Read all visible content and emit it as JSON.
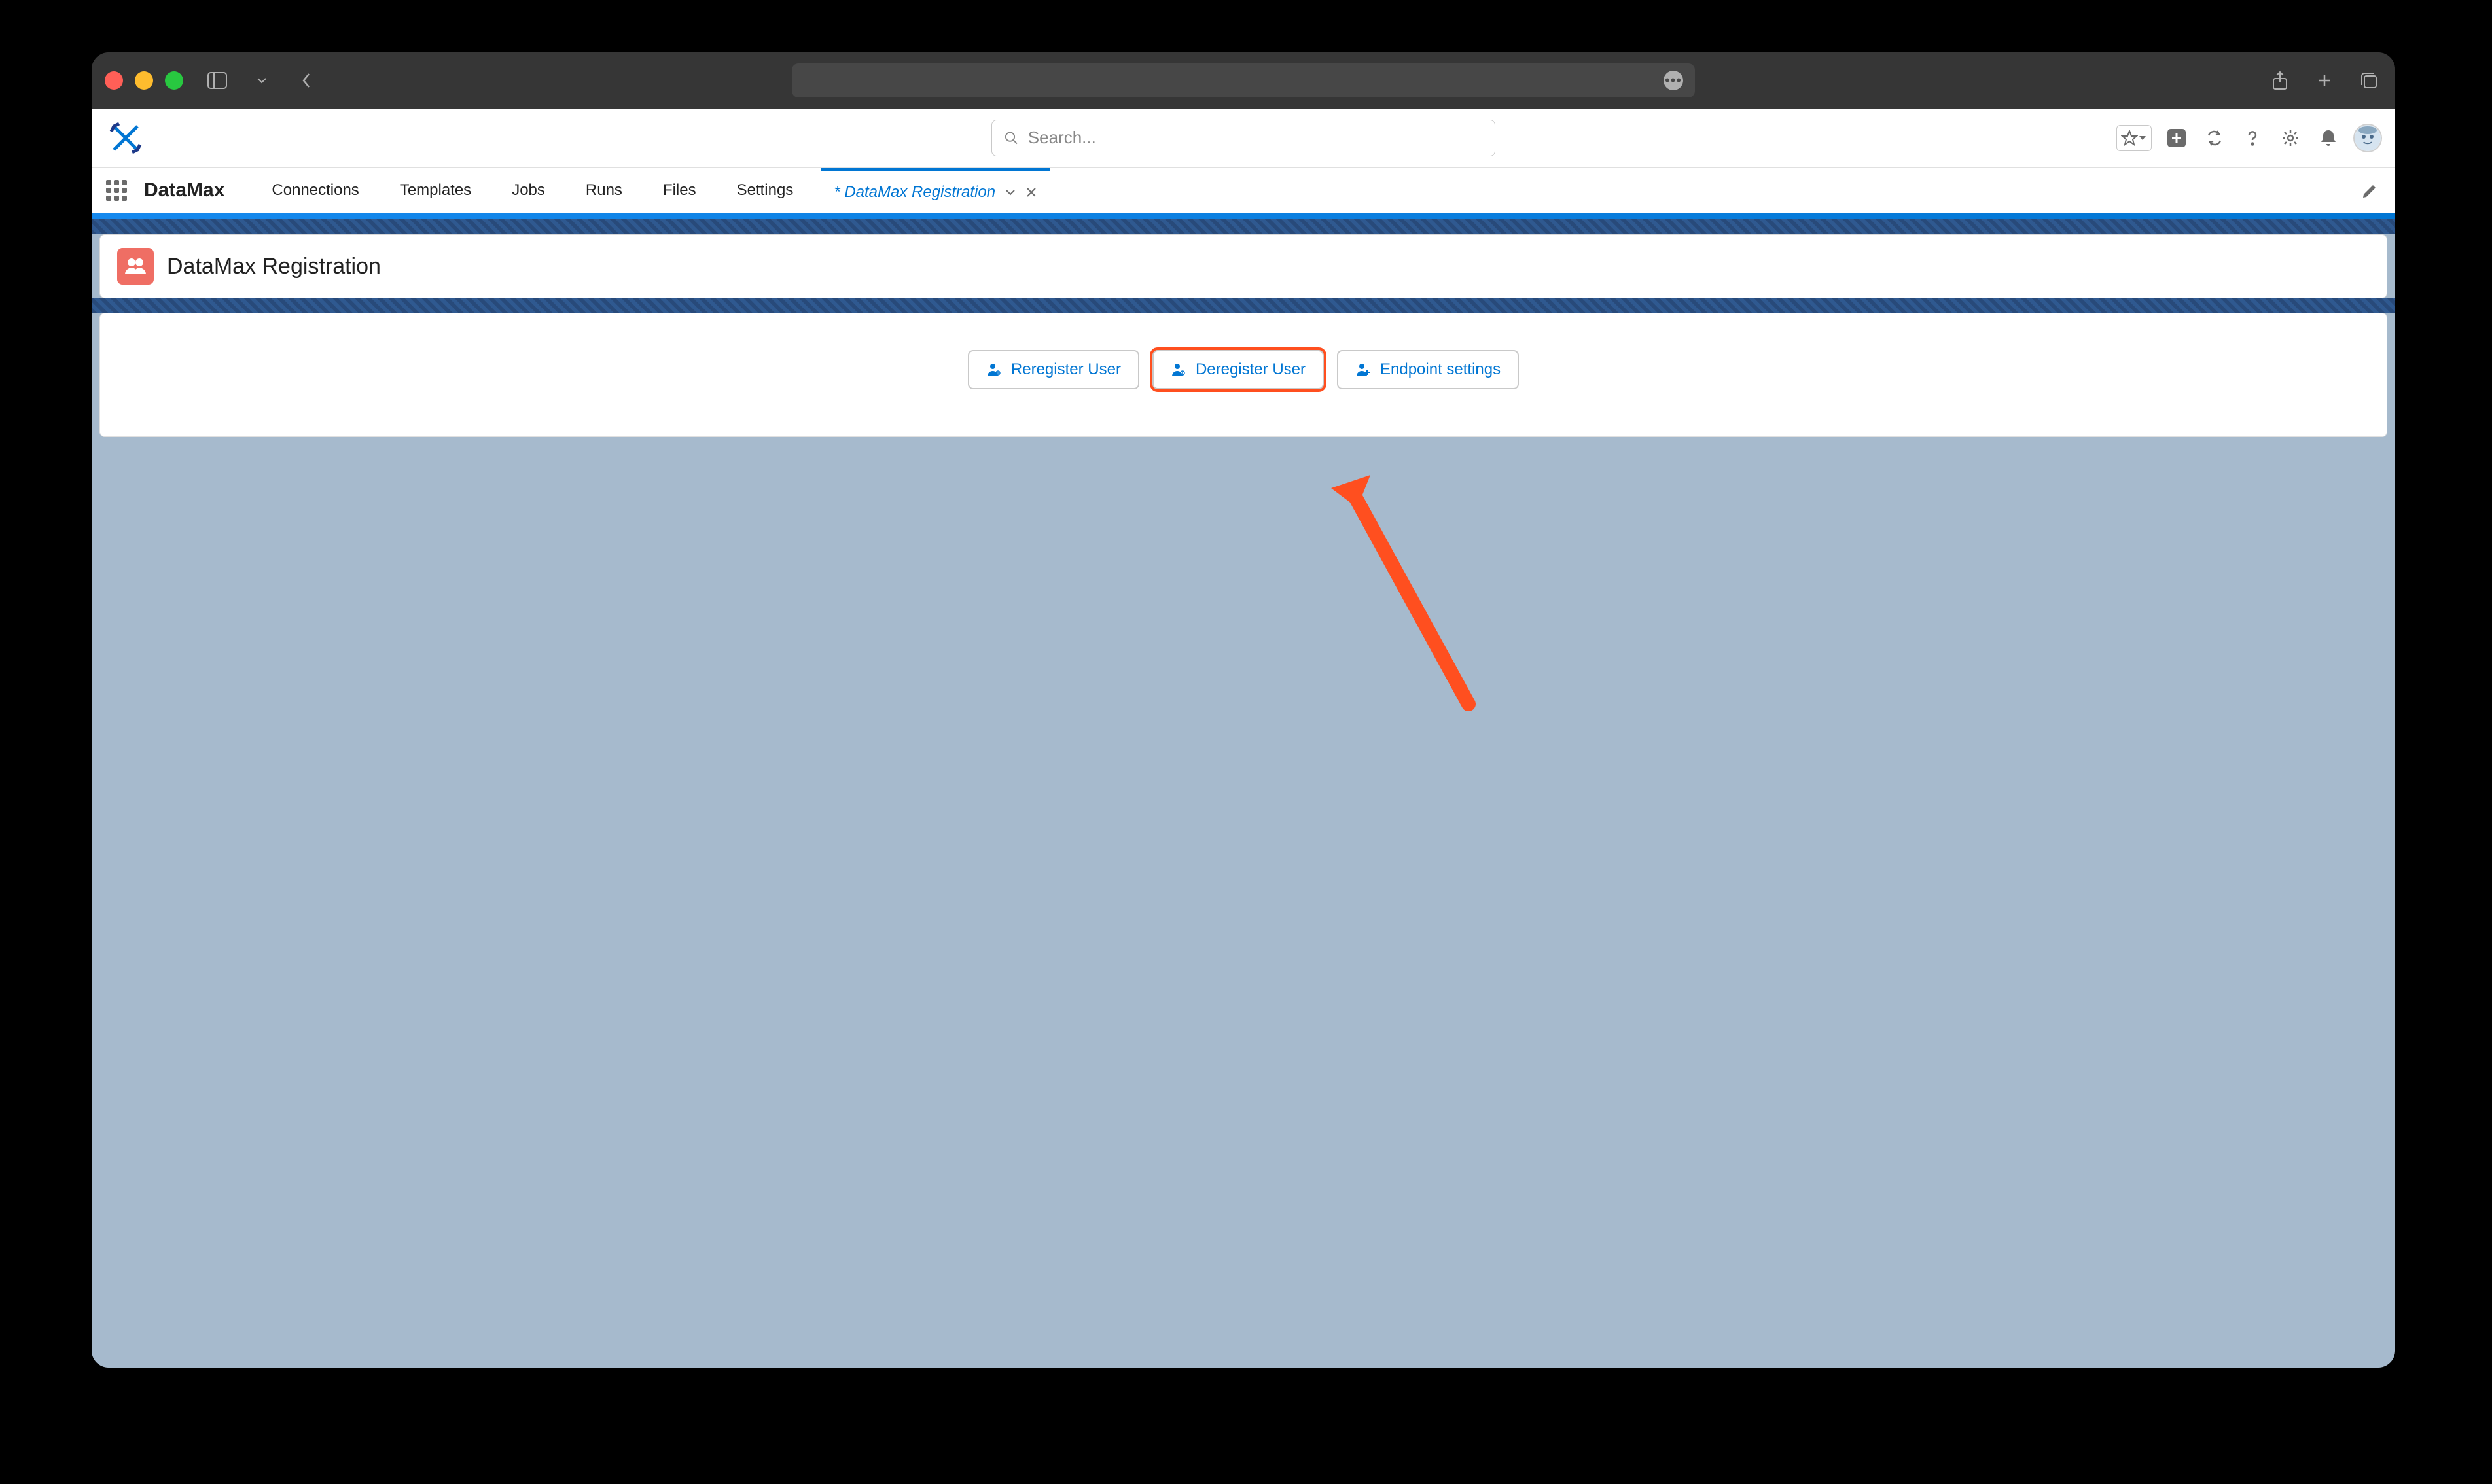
{
  "browser": {
    "address": ""
  },
  "search": {
    "placeholder": "Search..."
  },
  "app": {
    "name": "DataMax",
    "nav": [
      "Connections",
      "Templates",
      "Jobs",
      "Runs",
      "Files",
      "Settings"
    ],
    "active_tab": "* DataMax Registration"
  },
  "page": {
    "title": "DataMax Registration",
    "buttons": {
      "reregister": "Reregister User",
      "deregister": "Deregister User",
      "endpoint": "Endpoint settings"
    }
  }
}
